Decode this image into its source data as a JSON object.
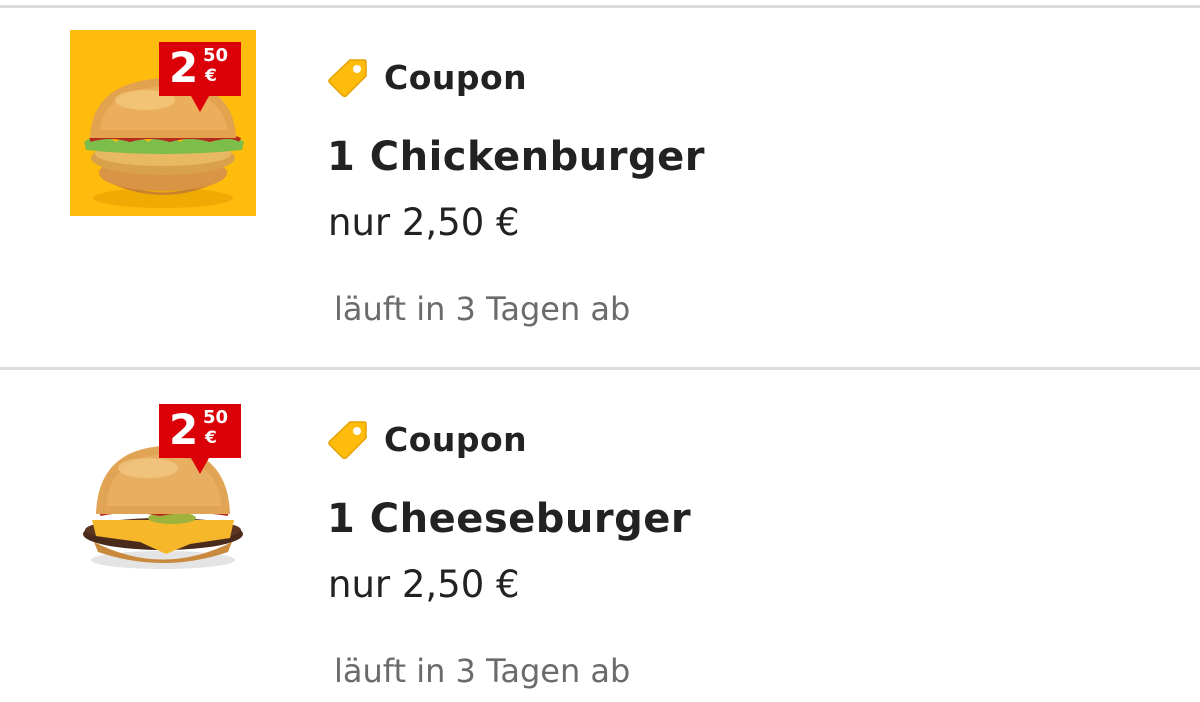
{
  "offers": [
    {
      "badge_main": "2",
      "badge_cents": "50",
      "badge_currency": "€",
      "thumb_background": "#FFBC0D",
      "product_icon": "chickenburger-image",
      "tag_icon": "coupon-tag-icon",
      "coupon_label": "Coupon",
      "title": "1 Chickenburger",
      "price": "nur 2,50 €",
      "expiry": "läuft in 3 Tagen ab"
    },
    {
      "badge_main": "2",
      "badge_cents": "50",
      "badge_currency": "€",
      "thumb_background": "#FFFFFF",
      "product_icon": "cheeseburger-image",
      "tag_icon": "coupon-tag-icon",
      "coupon_label": "Coupon",
      "title": "1 Cheeseburger",
      "price": "nur 2,50 €",
      "expiry": "läuft in 3 Tagen ab"
    }
  ],
  "colors": {
    "badge_red": "#DB0007",
    "tag_yellow": "#FFBC0D",
    "divider": "#DCDCDC",
    "expiry_text": "#6B6B6B"
  }
}
